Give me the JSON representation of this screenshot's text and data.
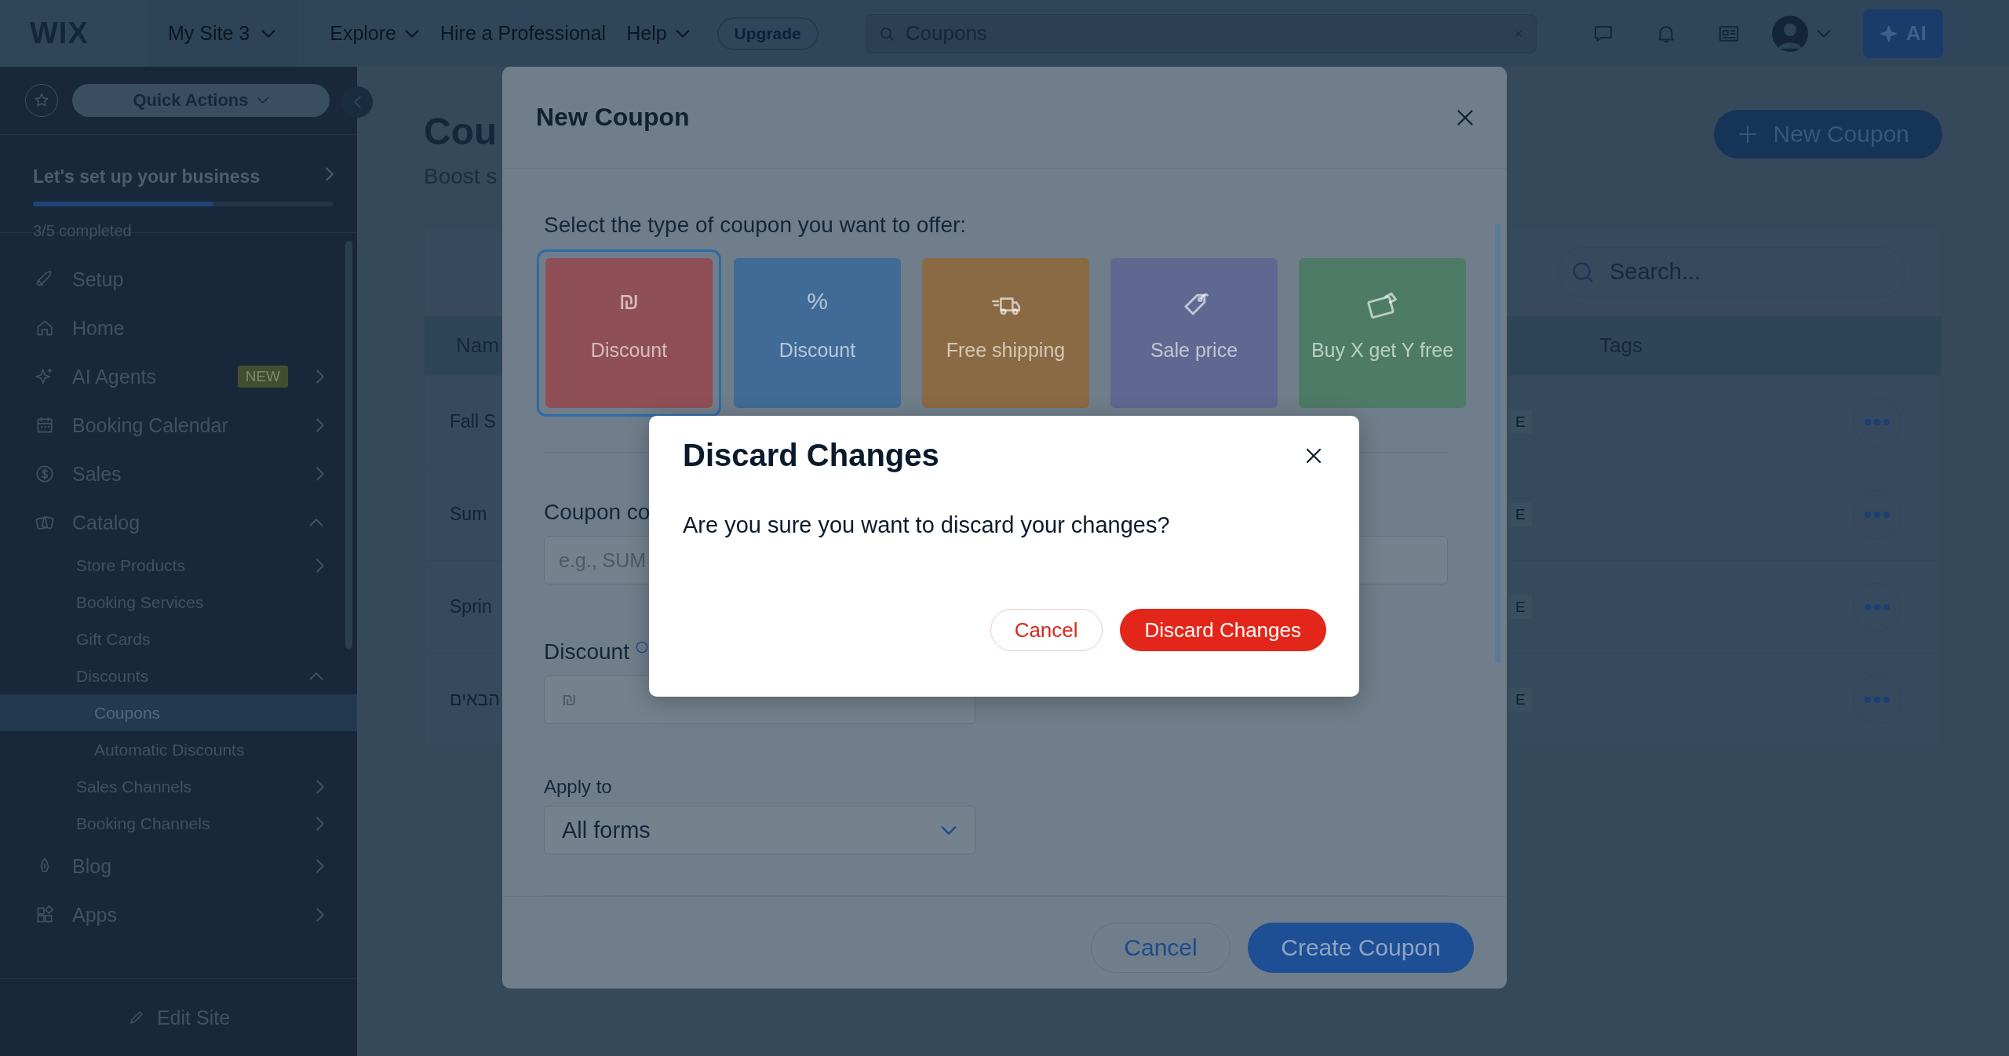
{
  "top_bar": {
    "logo": "WIX",
    "site": "My Site 3",
    "menu": [
      {
        "label": "Explore",
        "dropdown": true
      },
      {
        "label": "Hire a Professional",
        "dropdown": false
      },
      {
        "label": "Help",
        "dropdown": true
      }
    ],
    "upgrade": "Upgrade",
    "search": {
      "value": "Coupons"
    },
    "ai_button": "AI"
  },
  "sidebar": {
    "quick_actions": "Quick Actions",
    "setup": {
      "title": "Let's set up your business",
      "level": 0.6,
      "progress_text": "3/5 completed"
    },
    "items": [
      {
        "label": "Setup",
        "expandable": false,
        "expanded": false,
        "selected": false
      },
      {
        "label": "Home",
        "expandable": false,
        "expanded": false,
        "selected": false
      },
      {
        "label": "AI Agents",
        "badge": "NEW",
        "expandable": true,
        "expanded": false,
        "selected": false
      },
      {
        "label": "Booking Calendar",
        "expandable": true,
        "expanded": false,
        "selected": false
      },
      {
        "label": "Sales",
        "expandable": true,
        "expanded": false,
        "selected": false
      },
      {
        "label": "Catalog",
        "expandable": true,
        "expanded": true,
        "selected": false,
        "children": [
          {
            "label": "Store Products",
            "expandable": true,
            "expanded": false,
            "selected": false
          },
          {
            "label": "Booking Services",
            "expandable": false,
            "expanded": false,
            "selected": false
          },
          {
            "label": "Gift Cards",
            "expandable": false,
            "expanded": false,
            "selected": false
          },
          {
            "label": "Discounts",
            "expandable": true,
            "expanded": true,
            "selected": false,
            "children": [
              {
                "label": "Coupons",
                "expandable": false,
                "expanded": false,
                "selected": true
              },
              {
                "label": "Automatic Discounts",
                "expandable": false,
                "expanded": false,
                "selected": false
              }
            ]
          },
          {
            "label": "Sales Channels",
            "expandable": true,
            "expanded": false,
            "selected": false
          },
          {
            "label": "Booking Channels",
            "expandable": true,
            "expanded": false,
            "selected": false
          }
        ]
      },
      {
        "label": "Blog",
        "expandable": true,
        "expanded": false,
        "selected": false
      },
      {
        "label": "Apps",
        "expandable": true,
        "expanded": false,
        "selected": false
      }
    ],
    "edit_site": "Edit Site"
  },
  "page": {
    "title": "Cou",
    "subtitle": "Boost s",
    "new_button": "New Coupon",
    "search": {
      "placeholder": "Search..."
    },
    "table": {
      "columns": [
        "Nam",
        "Tags"
      ],
      "rows": [
        {
          "name": "Fall S",
          "status": "E"
        },
        {
          "name": "Sum",
          "status": "E"
        },
        {
          "name": "Sprin",
          "status": "E"
        },
        {
          "name": "הבאים",
          "status": "E"
        }
      ]
    }
  },
  "new_coupon_modal": {
    "title": "New Coupon",
    "prompt": "Select the type of coupon you want to offer:",
    "types": [
      {
        "label": "Discount",
        "symbol": "₪",
        "color": "#8f4f56",
        "selected": true
      },
      {
        "label": "Discount",
        "symbol": "%",
        "color": "#3f6b96",
        "selected": false
      },
      {
        "label": "Free shipping",
        "color": "#8a6a44",
        "selected": false
      },
      {
        "label": "Sale price",
        "color": "#5e6890",
        "selected": false
      },
      {
        "label": "Buy X get Y free",
        "color": "#4d7b66",
        "selected": false
      }
    ],
    "coupon_code": {
      "label": "Coupon co",
      "placeholder": "e.g., SUM"
    },
    "discount": {
      "label": "Discount",
      "prefix": "₪"
    },
    "apply_to": {
      "label": "Apply to",
      "value": "All forms"
    },
    "cancel": "Cancel",
    "create": "Create Coupon"
  },
  "discard_dialog": {
    "title": "Discard Changes",
    "message": "Are you sure you want to discard your changes?",
    "cancel": "Cancel",
    "confirm": "Discard Changes"
  }
}
